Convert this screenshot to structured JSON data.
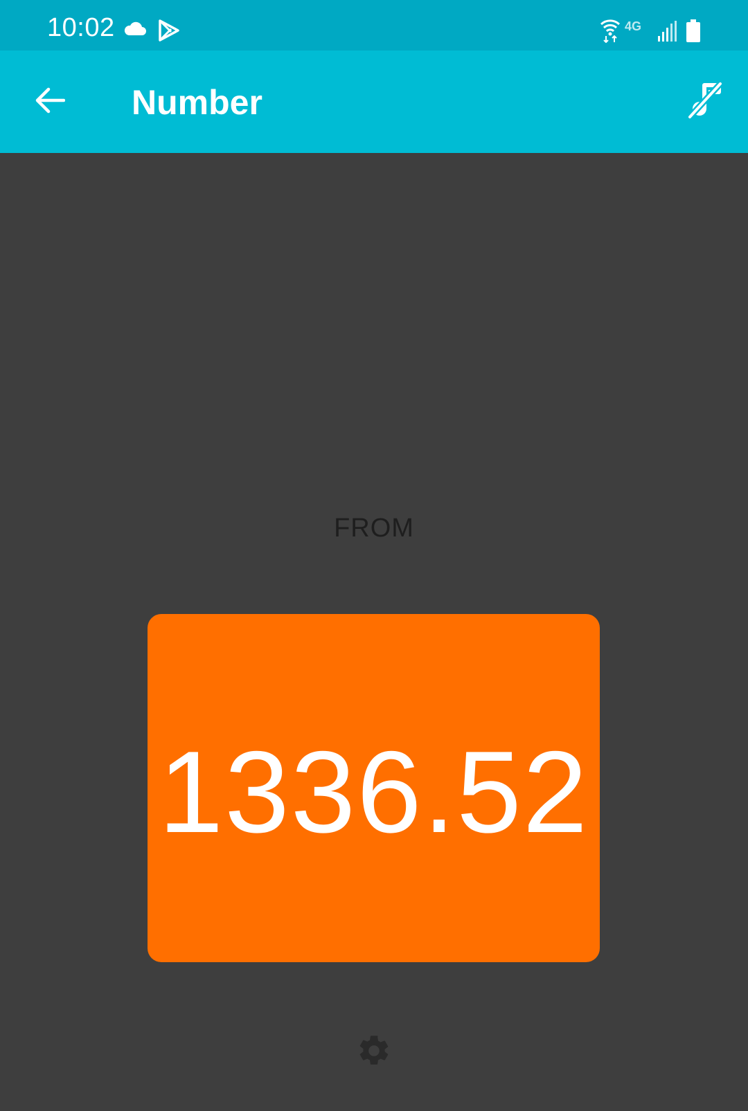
{
  "status_bar": {
    "time": "10:02",
    "network_label": "4G",
    "icons": [
      "cloud-icon",
      "play-store-icon",
      "wifi-icon",
      "lte-icon",
      "signal-icon",
      "battery-icon"
    ],
    "background_color": "#00a9c3"
  },
  "app_bar": {
    "title": "Number",
    "back_icon": "arrow-left-icon",
    "action_icon": "music-off-icon",
    "background_color": "#00bcd4"
  },
  "content": {
    "from_label": "FROM",
    "number_value": "1336.52",
    "card_color": "#ff6f00",
    "settings_icon": "gear-icon",
    "background_color": "#3e3e3e"
  }
}
